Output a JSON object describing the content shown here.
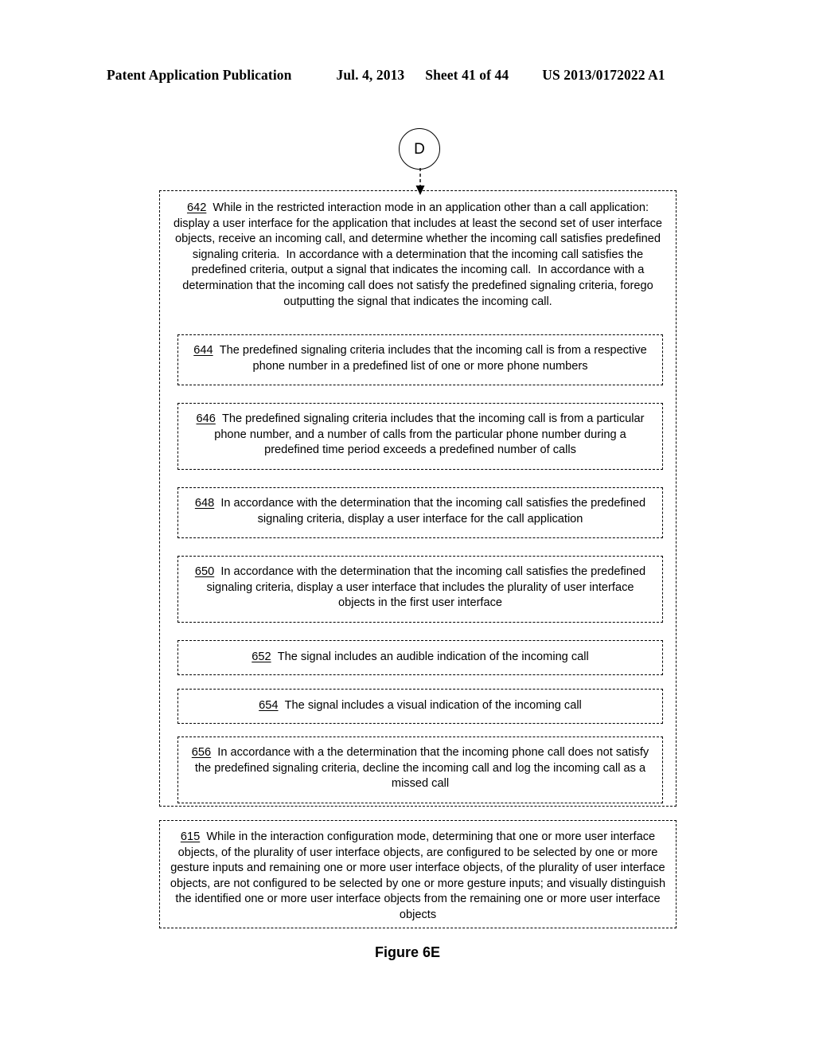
{
  "header": {
    "publication": "Patent Application Publication",
    "date": "Jul. 4, 2013",
    "sheet": "Sheet 41 of 44",
    "patent_number": "US 2013/0172022 A1"
  },
  "figure": {
    "caption": "Figure 6E",
    "connector": {
      "label": "D",
      "icon": "circle-connector"
    },
    "blocks": [
      {
        "ref": "642",
        "text": "While in the restricted interaction mode in an application other than a call application: display a user interface for the application that includes at least the second set of user interface objects, receive an incoming call, and determine whether the incoming call satisfies predefined signaling criteria.  In accordance with a determination that the incoming call satisfies the predefined criteria, output a signal that indicates the incoming call.  In accordance with a determination that the incoming call does not satisfy the predefined signaling criteria, forego outputting the signal that indicates the incoming call."
      },
      {
        "ref": "644",
        "text": "The predefined signaling criteria includes that the incoming call is from a respective phone number in a predefined list of one or more phone numbers"
      },
      {
        "ref": "646",
        "text": "The predefined signaling criteria includes that the incoming call is from a particular phone number, and a number of calls from the particular phone number during a predefined time period exceeds a predefined number of calls"
      },
      {
        "ref": "648",
        "text": "In accordance with the determination that the incoming call satisfies the predefined signaling criteria, display a user interface for the call application"
      },
      {
        "ref": "650",
        "text": "In accordance with the determination that the incoming call satisfies the predefined signaling criteria, display a user interface that includes the plurality of user interface objects in the first user interface"
      },
      {
        "ref": "652",
        "text": "The signal includes an audible indication of the incoming call"
      },
      {
        "ref": "654",
        "text": "The signal includes a visual indication of the incoming call"
      },
      {
        "ref": "656",
        "text": "In accordance with a the determination that the incoming phone call does not satisfy the predefined signaling criteria, decline the incoming call and log the incoming call as a missed call"
      },
      {
        "ref": "615",
        "text": "While in the interaction configuration mode, determining that one or more user interface objects, of the plurality of user interface objects, are configured to be selected by one or more gesture inputs and remaining one or more user interface objects, of the plurality of user interface objects, are not configured to be selected by one or more gesture inputs; and visually distinguish the identified one or more user interface objects from the remaining one or more user interface objects"
      }
    ]
  },
  "colors": {
    "ink": "#000000",
    "page": "#ffffff"
  }
}
